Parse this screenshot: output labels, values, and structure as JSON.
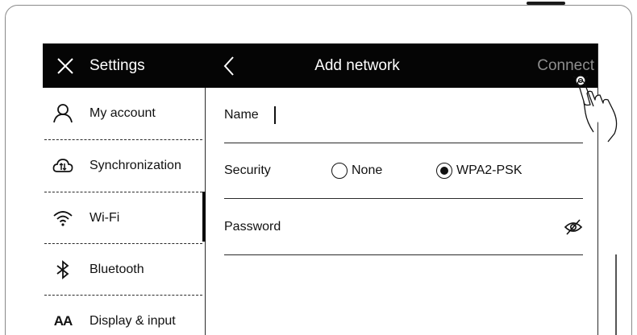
{
  "topbar": {
    "close_icon": "close-icon",
    "settings_title": "Settings",
    "back_icon": "chevron-left-icon",
    "page_title": "Add network",
    "connect_label": "Connect"
  },
  "sidebar": {
    "items": [
      {
        "label": "My account",
        "icon": "person-icon"
      },
      {
        "label": "Synchronization",
        "icon": "cloud-sync-icon"
      },
      {
        "label": "Wi-Fi",
        "icon": "wifi-icon",
        "active": true
      },
      {
        "label": "Bluetooth",
        "icon": "bluetooth-icon"
      },
      {
        "label": "Display & input",
        "icon": "font-size-icon",
        "icon_text": "AA"
      }
    ]
  },
  "form": {
    "name_label": "Name",
    "name_value": "",
    "security_label": "Security",
    "security_options": [
      {
        "label": "None",
        "selected": false
      },
      {
        "label": "WPA2-PSK",
        "selected": true
      }
    ],
    "password_label": "Password",
    "password_visibility_icon": "eye-off-icon"
  },
  "colors": {
    "topbar_bg": "#050505",
    "topbar_text": "#ffffff",
    "connect_disabled": "#8e8e8e",
    "text": "#111111"
  }
}
